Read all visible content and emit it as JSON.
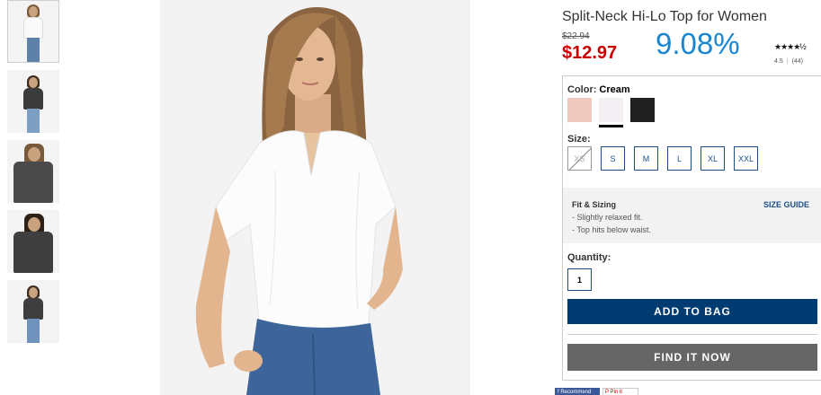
{
  "product": {
    "title": "Split-Neck Hi-Lo Top for Women",
    "was_price": "$22.94",
    "now_price": "$12.97",
    "discount": "9.08%",
    "stars": "★★★★½",
    "rating_value": "4.5",
    "rating_sep": "|",
    "rating_count": "(44)"
  },
  "color": {
    "label": "Color:",
    "selected": "Cream",
    "swatches": [
      {
        "name": "blush",
        "hex": "#efc8c0"
      },
      {
        "name": "cream",
        "hex": "#f4eff2"
      },
      {
        "name": "black",
        "hex": "#202020"
      }
    ]
  },
  "size": {
    "label": "Size:",
    "options": [
      "XS",
      "S",
      "M",
      "L",
      "XL",
      "XXL"
    ],
    "unavailable": [
      "XS"
    ]
  },
  "fit": {
    "title": "Fit & Sizing",
    "size_guide": "SIZE GUIDE",
    "lines": [
      "- Slightly relaxed fit.",
      "- Top hits below waist."
    ]
  },
  "quantity": {
    "label": "Quantity:",
    "value": "1"
  },
  "actions": {
    "add_to_bag": "ADD TO BAG",
    "find_it_now": "FIND IT NOW"
  },
  "social": {
    "facebook": "f Recommend",
    "pinterest": "P Pin it"
  },
  "colors": {
    "primary_blue": "#003c71",
    "sale_red": "#cc0000",
    "discount_blue": "#1a86d0",
    "find_gray": "#666666"
  }
}
